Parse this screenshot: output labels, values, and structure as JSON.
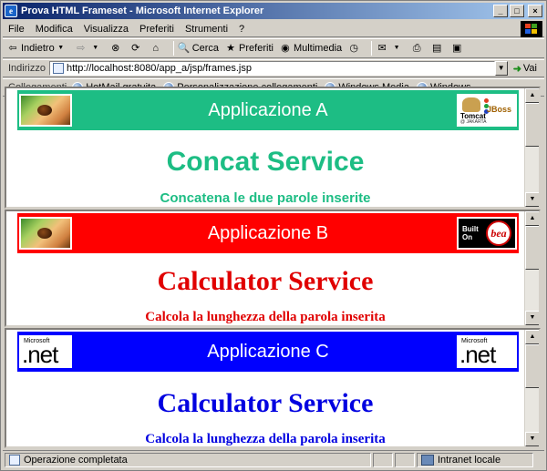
{
  "window": {
    "title": "Prova HTML Frameset - Microsoft Internet Explorer",
    "title_icon": "e",
    "btn_min": "_",
    "btn_max": "□",
    "btn_close": "×"
  },
  "menu": [
    "File",
    "Modifica",
    "Visualizza",
    "Preferiti",
    "Strumenti",
    "?"
  ],
  "toolbar": {
    "back": "Indietro",
    "search": "Cerca",
    "favorites": "Preferiti",
    "media": "Multimedia"
  },
  "address": {
    "label": "Indirizzo",
    "url": "http://localhost:8080/app_a/jsp/frames.jsp",
    "go": "Vai"
  },
  "links": {
    "label": "Collegamenti",
    "items": [
      "HotMail gratuita",
      "Personalizzazione collegamenti",
      "Windows Media",
      "Windows"
    ]
  },
  "frames": [
    {
      "banner_title": "Applicazione A",
      "banner_color": "#1dbd84",
      "service_title": "Concat Service",
      "service_sub": "Concatena le due parole inserite",
      "text_color": "#1dbd84",
      "right_logo": "tomcat-jboss"
    },
    {
      "banner_title": "Applicazione B",
      "banner_color": "#ff0000",
      "service_title": "Calculator Service",
      "service_sub": "Calcola la lunghezza della parola inserita",
      "text_color": "#e00000",
      "right_logo": "bea"
    },
    {
      "banner_title": "Applicazione C",
      "banner_color": "#0000ff",
      "service_title": "Calculator Service",
      "service_sub": "Calcola la lunghezza della parola inserita",
      "text_color": "#0000e0",
      "right_logo": "dotnet"
    }
  ],
  "logos": {
    "tomcat": "Tomcat",
    "jakarta": "@ JAKARTA",
    "jboss": "JBoss",
    "built_on": "Built On",
    "bea": "bea",
    "microsoft": "Microsoft",
    "net": ".net"
  },
  "status": {
    "text": "Operazione completata",
    "zone": "Intranet locale"
  }
}
